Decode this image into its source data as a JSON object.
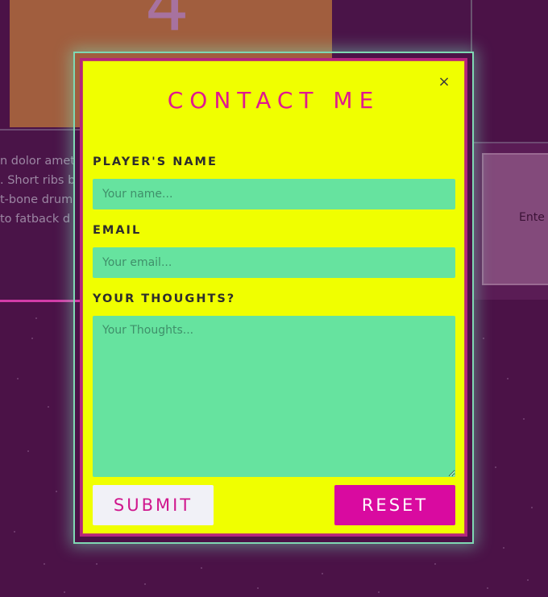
{
  "background": {
    "card_digit": "4",
    "left_card_lines": [
      "n dolor amet",
      ". Short ribs b",
      " t-bone drum",
      "to fatback d"
    ],
    "right_card_text": "Ente"
  },
  "modal": {
    "title": "CONTACT ME",
    "close_glyph": "×",
    "fields": {
      "name_label": "PLAYER'S NAME",
      "name_placeholder": "Your name...",
      "email_label": "EMAIL",
      "email_placeholder": "Your email...",
      "thoughts_label": "YOUR THOUGHTS?",
      "thoughts_placeholder": "Your Thoughts..."
    },
    "buttons": {
      "submit": "SUBMIT",
      "reset": "RESET"
    }
  },
  "colors": {
    "page_bg": "#4b1247",
    "modal_bg": "#f0ff00",
    "accent_pink": "#e0188f",
    "field_green": "#66e39f",
    "reset_bg": "#d90aa0",
    "glow": "#7fd8b3"
  }
}
